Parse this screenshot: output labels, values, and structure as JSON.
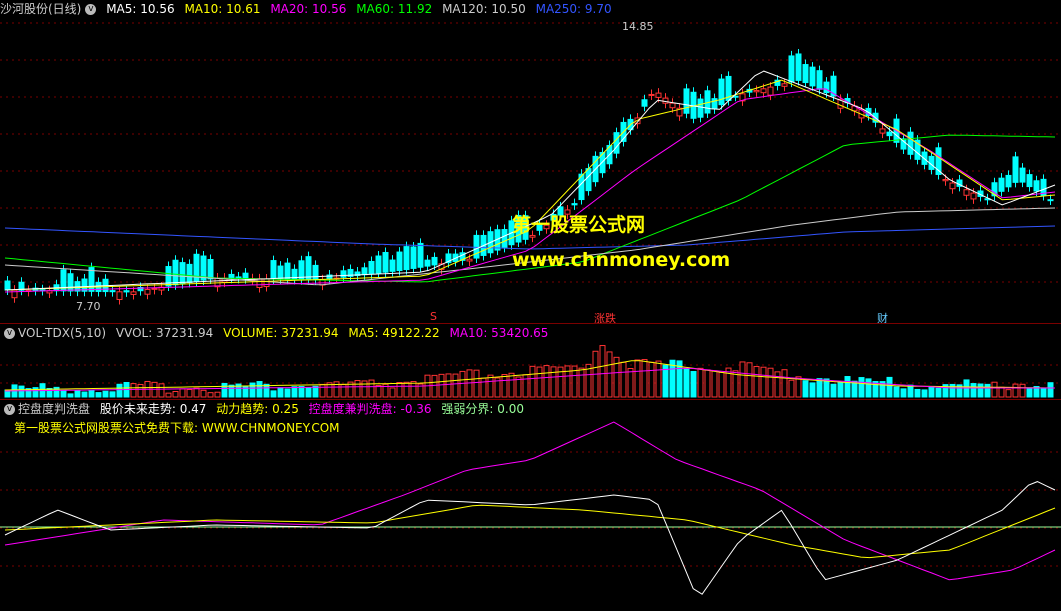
{
  "colors": {
    "up": "#ff3333",
    "down": "#00ffff",
    "ma5": "#ffffff",
    "ma10": "#ffff00",
    "ma20": "#ff00ff",
    "ma60": "#00ff00",
    "ma120": "#cccccc",
    "ma250": "#3355ff",
    "grid": "#7a0000"
  },
  "price_header": {
    "title": "沙河股份(日线)",
    "ma5": "MA5: 10.56",
    "ma10": "MA10: 10.61",
    "ma20": "MA20: 10.56",
    "ma60": "MA60: 11.92",
    "ma120": "MA120: 10.50",
    "ma250": "MA250: 9.70"
  },
  "price_annotations": {
    "high": "14.85",
    "low": "7.70"
  },
  "event_markers": {
    "s": "S",
    "zhangdie": "涨跌",
    "cai": "财"
  },
  "watermark": {
    "line1": "第一股票公式网",
    "line2": "www.chnmoney.com"
  },
  "vol_header": {
    "name": "VOL-TDX(5,10)",
    "vvol": "VVOL: 37231.94",
    "volume": "VOLUME: 37231.94",
    "ma5": "MA5: 49122.22",
    "ma10": "MA10: 53420.65"
  },
  "ind_header": {
    "name": "控盘度判洗盘",
    "trend": "股价未来走势: 0.47",
    "power": "动力趋势: 0.25",
    "wash": "控盘度兼判洗盘: -0.36",
    "boundary": "强弱分界: 0.00",
    "promo": "第一股票公式网股票公式免费下载: WWW.CHNMONEY.COM"
  }
}
